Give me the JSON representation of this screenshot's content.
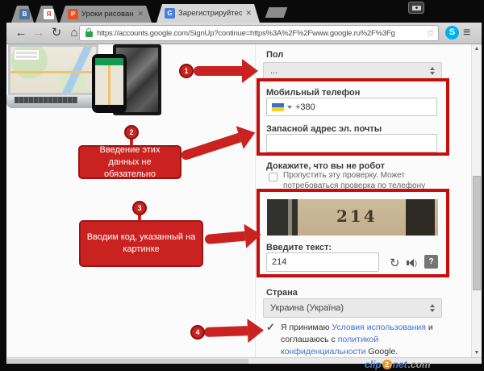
{
  "colors": {
    "accent_red": "#c92220",
    "outline_red": "#c40f0c",
    "link_blue": "#4272d9",
    "skype_blue": "#00aff0"
  },
  "titlebar": {
    "tabs": [
      {
        "icon_letter": "В"
      },
      {
        "icon_letter": "Я"
      },
      {
        "icon_letter": "P",
        "label": "Уроки рисования каран…",
        "close": "✕"
      },
      {
        "icon_letter": "G",
        "label": "Зарегистрируйтесь в Go…",
        "close": "✕"
      }
    ]
  },
  "toolbar": {
    "back": "←",
    "forward": "→",
    "reload": "↻",
    "home": "⌂",
    "url": "https://accounts.google.com/SignUp?continue=https%3A%2F%2Fwww.google.ru%2F%3Fg",
    "bookmark_star": "☆",
    "skype_letter": "S",
    "menu": "≡"
  },
  "scrollbar": {
    "up": "▲",
    "down": "▼"
  },
  "form": {
    "gender": {
      "label": "Пол",
      "value": "..."
    },
    "phone": {
      "label": "Мобильный телефон",
      "prefix": "+380"
    },
    "recovery": {
      "label": "Запасной адрес эл. почты",
      "value": ""
    },
    "robot": {
      "label": "Докажите, что вы не робот",
      "skip_text": "Пропустить эту проверку. Может потребоваться проверка по телефону"
    },
    "captcha": {
      "image_text": "214",
      "prompt": "Введите текст:",
      "input_value": "214",
      "help": "?",
      "wave": ")"
    },
    "country": {
      "label": "Страна",
      "value": "Украина (Україна)"
    },
    "agree": {
      "check": "✓",
      "prefix": "Я принимаю ",
      "link1": "Условия использования",
      "middle": " и соглашаюсь с ",
      "link2": "политикой конфиденциальности",
      "suffix": " Google."
    }
  },
  "annotations": {
    "step1": {
      "number": "1"
    },
    "step2": {
      "number": "2",
      "text": "Введение этих данных не обязательно"
    },
    "step3": {
      "number": "3",
      "text": "Вводим код, указанный на картинке"
    },
    "step4": {
      "number": "4"
    }
  },
  "watermark": {
    "part1": "clip",
    "part2": "2",
    "part3": "net",
    "part4": ".com"
  }
}
